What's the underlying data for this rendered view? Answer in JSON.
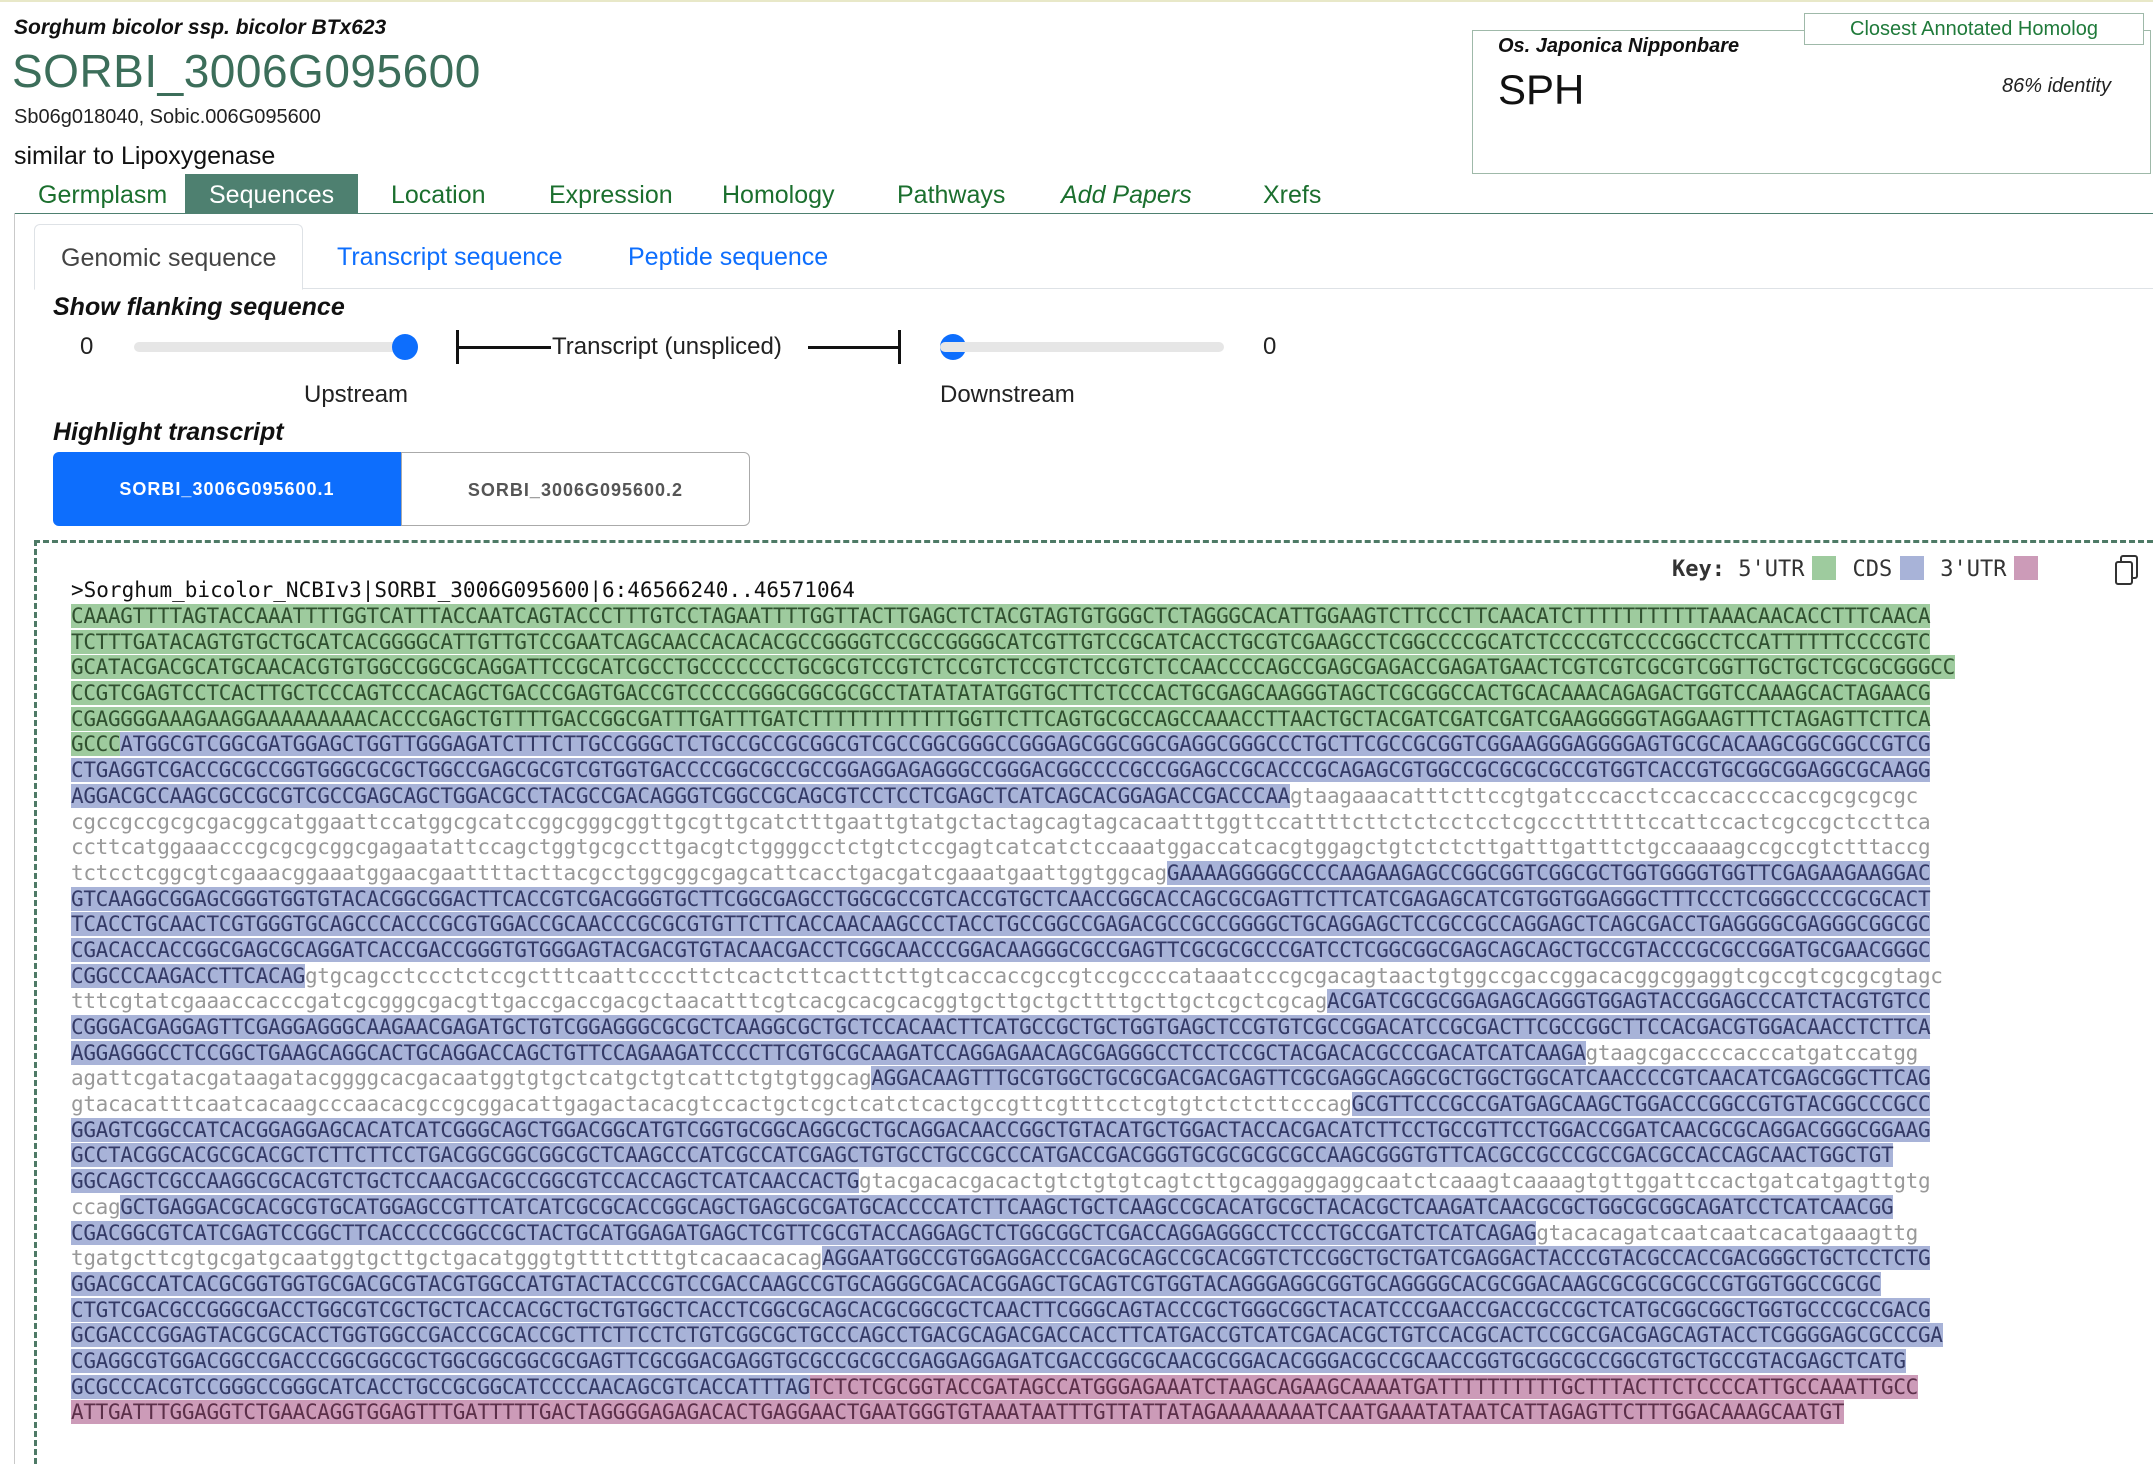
{
  "gene": {
    "species": "Sorghum bicolor ssp. bicolor BTx623",
    "id": "SORBI_3006G095600",
    "synonyms": "Sb06g018040, Sobic.006G095600",
    "description": "similar to Lipoxygenase"
  },
  "homolog": {
    "badge": "Closest Annotated Homolog",
    "species": "Os. Japonica Nipponbare",
    "name": "SPH",
    "identity": "86% identity"
  },
  "nav": {
    "tabs": [
      "Germplasm",
      "Sequences",
      "Location",
      "Expression",
      "Homology",
      "Pathways",
      "Add Papers",
      "Xrefs"
    ],
    "active": "Sequences"
  },
  "subtabs": {
    "items": [
      "Genomic sequence",
      "Transcript sequence",
      "Peptide sequence"
    ],
    "active": "Genomic sequence"
  },
  "flanking": {
    "title": "Show flanking sequence",
    "upstream_value": "0",
    "upstream_label": "Upstream",
    "downstream_value": "0",
    "downstream_label": "Downstream",
    "transcript_label": "Transcript (unspliced)"
  },
  "highlight": {
    "title": "Highlight transcript",
    "transcripts": [
      "SORBI_3006G095600.1",
      "SORBI_3006G095600.2"
    ],
    "active": "SORBI_3006G095600.1"
  },
  "key": {
    "label": "Key:",
    "utr5": "5'UTR",
    "cds": "CDS",
    "utr3": "3'UTR"
  },
  "colors": {
    "utr5": "#9ecb9e",
    "cds": "#a8b3d8",
    "utr3": "#cc9bb8",
    "intron_text": "#999999",
    "nav_active": "#4e8070",
    "link_green": "#1b6f2e",
    "link_blue": "#0d6efd"
  },
  "icons": {
    "copy": "copy-icon"
  },
  "sequence": {
    "header": ">Sorghum_bicolor_NCBIv3|SORBI_3006G095600|6:46566240..46571064",
    "lines": [
      [
        [
          "utr5",
          "CAAAGTTTTAGTACCAAATTTTGGTCATTTACCAATCAGTACCCTTTGTCCTAGAATTTTGGTTACTTGAGCTCTACGTAGTGTGGGCTCTAGGGCACATTGGAAGTCTTCCCTTCAACATCTTTTTTTTTTTAAACAACACCTTTCAACA"
        ]
      ],
      [
        [
          "utr5",
          "TCTTTGATACAGTGTGCTGCATCACGGGGCATTGTTGTCCGAATCAGCAACCACACACGCCGGGGTCCGCCGGGGCATCGTTGTCCGCATCACCTGCGTCGAAGCCTCGGCCCCGCATCTCCCCGTCCCCGGCCTCCATTTTTTCCCCGTC"
        ]
      ],
      [
        [
          "utr5",
          "GCATACGACGCATGCAACACGTGTGGCCGGCGCAGGATTCCGCATCGCCTGCCCCCCCTGCGCGTCCGTCTCCGTCTCCGTCTCCGTCTCCAACCCCAGCCGAGCGAGACCGAGATGAACTCGTCGTCGCGTCGGTTGCTGCTCGCGCGGGCC"
        ]
      ],
      [
        [
          "utr5",
          "CCGTCGAGTCCTCACTTGCTCCCAGTCCCACAGCTGACCCGAGTGACCGTCCCCCGGGCGGCGCGCCTATATATATGGTGCTTCTCCCACTGCGAGCAAGGGTAGCTCGCGGCCACTGCACAAACAGAGACTGGTCCAAAGCACTAGAACG"
        ]
      ],
      [
        [
          "utr5",
          "CGAGGGGAAAGAAGGAAAAAAAAACACCCGAGCTGTTTTGACCGGCGATTTGATTTGATCTTTTTTTTTTTTGGTTCTTCAGTGCGCCAGCCAAACCTTAACTGCTACGATCGATCGATCGAAGGGGGTAGGAAGTTTCTAGAGTTCTTCA"
        ]
      ],
      [
        [
          "utr5",
          "GCCC"
        ],
        [
          "cds",
          "ATGGCGTCGGCGATGGAGCTGGTTGGGAGATCTTTCTTGCCGGGCTCTGCCGCCGCGGCGTCGCCGGCGGGCCGGGAGCGGCGGCGAGGCGGGCCCTGCTTCGCCGCGGTCGGAAGGGAGGGGAGTGCGCACAAGCGGCGGCCGTCG"
        ]
      ],
      [
        [
          "cds",
          "CTGAGGTCGACCGCGCCGGTGGGCGCGCTGGCCGAGCGCGTCGTGGTGACCCCGGCGCCGCCGGAGGAGAGGGCCGGGACGGCCCCGCCGGAGCCGCACCCGCAGAGCGTGGCCGCGCGCGCCGTGGTCACCGTGCGGCGGAGGCGCAAGG"
        ]
      ],
      [
        [
          "cds",
          "AGGACGCCAAGCGCCGCGTCGCCGAGCAGCTGGACGCCTACGCCGACAGGGTCGGCCGCAGCGTCCTCCTCGAGCTCATCAGCACGGAGACCGACCCAA"
        ],
        [
          "intron",
          "gtaagaaacatttcttccgtgatcccacctccaccaccccaccgcgcgcgc"
        ]
      ],
      [
        [
          "intron",
          "cgccgccgcgcgacggcatggaattccatggcgcatccggcgggcggttgcgttgcatctttgaattgtatgctactagcagtagcacaatttggttccattttcttctctcctcctcgcccttttttccattccactcgccgctccttca"
        ]
      ],
      [
        [
          "intron",
          "ccttcatggaaacccgcgcgcggcgagaatattccagctggtgcgccttgacgtctggggcctctgtctccgagtcatcatctccaaatggaccatcacgtggagctgtctctcttgatttgatttctgccaaaagccgccgtctttaccg"
        ]
      ],
      [
        [
          "intron",
          "tctcctcggcgtcgaaacggaaatggaacgaattttacttacgcctggcggcgagcattcacctgacgatcgaaatgaattggtggcag"
        ],
        [
          "cds",
          "GAAAAGGGGGCCCCAAGAAGAGCCGGCGGTCGGCGCTGGTGGGGTGGTTCGAGAAGAAGGAC"
        ]
      ],
      [
        [
          "cds",
          "GTCAAGGCGGAGCGGGTGGTGTACACGGCGGACTTCACCGTCGACGGGTGCTTCGGCGAGCCTGGCGCCGTCACCGTGCTCAACCGGCACCAGCGCGAGTTCTTCATCGAGAGCATCGTGGTGGAGGGCTTTCCCTCGGGCCCCGCGCACT"
        ]
      ],
      [
        [
          "cds",
          "TCACCTGCAACTCGTGGGTGCAGCCCACCCGCGTGGACCGCAACCCGCGCGTGTTCTTCACCAACAAGCCCTACCTGCCGGCCGAGACGCCGCCGGGGCTGCAGGAGCTCCGCCGCCAGGAGCTCAGCGACCTGAGGGGCGAGGGCGGCGC"
        ]
      ],
      [
        [
          "cds",
          "CGACACCACCGGCGAGCGCAGGATCACCGACCGGGTGTGGGAGTACGACGTGTACAACGACCTCGGCAACCCGGACAAGGGCGCCGAGTTCGCGCGCCCGATCCTCGGCGGCGAGCAGCAGCTGCCGTACCCGCGCCGGATGCGAACGGGC"
        ]
      ],
      [
        [
          "cds",
          "CGGCCCAAGACCTTCACAG"
        ],
        [
          "intron",
          "gtgcagcctccctctccgctttcaattccccttctcactcttcacttcttgtcaccaccgccgtccgccccataaatcccgcgacagtaactgtggccgaccggacacggcggaggtcgccgtcgcgcgtagc"
        ]
      ],
      [
        [
          "intron",
          "tttcgtatcgaaaccacccgatcgcgggcgacgttgaccgaccgacgctaacatttcgtcacgcacgcacggtgcttgctgcttttgcttgctcgctcgcag"
        ],
        [
          "cds",
          "ACGATCGCGCGGAGAGCAGGGTGGAGTACCGGAGCCCATCTACGTGTCC"
        ]
      ],
      [
        [
          "cds",
          "CGGGACGAGGAGTTCGAGGAGGGCAAGAACGAGATGCTGTCGGAGGGCGCGCTCAAGGCGCTGCTCCACAACTTCATGCCGCTGCTGGTGAGCTCCGTGTCGCCGGACATCCGCGACTTCGCCGGCTTCCACGACGTGGACAACCTCTTCA"
        ]
      ],
      [
        [
          "cds",
          "AGGAGGGCCTCCGGCTGAAGCAGGCACTGCAGGACCAGCTGTTCCAGAAGATCCCCTTCGTGCGCAAGATCCAGGAGAACAGCGAGGGCCTCCTCCGCTACGACACGCCCGACATCATCAAGA"
        ],
        [
          "intron",
          "gtaagcgaccccacccatgatccatgg"
        ]
      ],
      [
        [
          "intron",
          "agattcgatacgataagatacggggcacgacaatggtgtgctcatgctgtcattctgtgtggcag"
        ],
        [
          "cds",
          "AGGACAAGTTTGCGTGGCTGCGCGACGACGAGTTCGCGAGGCAGGCGCTGGCTGGCATCAACCCCGTCAACATCGAGCGGCTTCAG"
        ]
      ],
      [
        [
          "intron",
          "gtacacatttcaatcacaagcccaacacgccgcggacattgagactacacgtccactgctcgctcatctcactgccgttcgtttcctcgtgtctctcttcccag"
        ],
        [
          "cds",
          "GCGTTCCCGCCGATGAGCAAGCTGGACCCGGCCGTGTACGGCCCGCC"
        ]
      ],
      [
        [
          "cds",
          "GGAGTCGGCCATCACGGAGGAGCACATCATCGGGCAGCTGGACGGCATGTCGGTGCGGCAGGCGCTGCAGGACAACCGGCTGTACATGCTGGACTACCACGACATCTTCCTGCCGTTCCTGGACCGGATCAACGCGCAGGACGGGCGGAAG"
        ]
      ],
      [
        [
          "cds",
          "GCCTACGGCACGCGCACGCTCTTCTTCCTGACGGCGGCGGCGCTCAAGCCCATCGCCATCGAGCTGTGCCTGCCGCCCATGACCGACGGGTGCGCGCGCGCCAAGCGGGTGTTCACGCCGCCCGCCGACGCCACCAGCAACTGGCTGT"
        ]
      ],
      [
        [
          "cds",
          "GGCAGCTCGCCAAGGCGCACGTCTGCTCCAACGACGCCGGCGTCCACCAGCTCATCAACCACTG"
        ],
        [
          "intron",
          "gtacgacacgacactgtctgtgtcagtcttgcaggaggaggcaatctcaaagtcaaaagtgttggattccactgatcatgagttgtg"
        ]
      ],
      [
        [
          "intron",
          "ccag"
        ],
        [
          "cds",
          "GCTGAGGACGCACGCGTGCATGGAGCCGTTCATCATCGCGCACCGGCAGCTGAGCGCGATGCACCCCATCTTCAAGCTGCTCAAGCCGCACATGCGCTACACGCTCAAGATCAACGCGCTGGCGCGGCAGATCCTCATCAACGG"
        ]
      ],
      [
        [
          "cds",
          "CGACGGCGTCATCGAGTCCGGCTTCACCCCCGGCCGCTACTGCATGGAGATGAGCTCGTTCGCGTACCAGGAGCTCTGGCGGCTCGACCAGGAGGGCCTCCCTGCCGATCTCATCAGAG"
        ],
        [
          "intron",
          "gtacacagatcaatcaatcacatgaaagttg"
        ]
      ],
      [
        [
          "intron",
          "tgatgcttcgtgcgatgcaatggtgcttgctgacatgggtgttttctttgtcacaacacag"
        ],
        [
          "cds",
          "AGGAATGGCCGTGGAGGACCCGACGCAGCCGCACGGTCTCCGGCTGCTGATCGAGGACTACCCGTACGCCACCGACGGGCTGCTCCTCTG"
        ]
      ],
      [
        [
          "cds",
          "GGACGCCATCACGCGGTGGTGCGACGCGTACGTGGCCATGTACTACCCGTCCGACCAAGCCGTGCAGGGCGACACGGAGCTGCAGTCGTGGTACAGGGAGGCGGTGCAGGGGCACGCGGACAAGCGCGCGCGCCGTGGTGGCCGCGC"
        ]
      ],
      [
        [
          "cds",
          "CTGTCGACGCCGGGCGACCTGGCGTCGCTGCTCACCACGCTGCTGTGGCTCACCTCGGCGCAGCACGCGGCGCTCAACTTCGGGCAGTACCCGCTGGGCGGCTACATCCCGAACCGACCGCCGCTCATGCGGCGGCTGGTGCCCGCCGACG"
        ]
      ],
      [
        [
          "cds",
          "GCGACCCGGAGTACGCGCACCTGGTGGCCGACCCGCACCGCTTCTTCCTCTGTCGGCGCTGCCCAGCCTGACGCAGACGACCACCTTCATGACCGTCATCGACACGCTGTCCACGCACTCCGCCGACGAGCAGTACCTCGGGGAGCGCCCGA"
        ]
      ],
      [
        [
          "cds",
          "CGAGGCGTGGACGGCCGACCCGGCGGCGCTGGCGGCGGCGCGAGTTCGCGGACGAGGTGCGCCGCGCCGAGGAGGAGATCGACCGGCGCAACGCGGACACGGGACGCCGCAACCGGTGCGGCGCCGGCGTGCTGCCGTACGAGCTCATG"
        ]
      ],
      [
        [
          "cds",
          "GCGCCCACGTCCGGGCCGGGCATCACCTGCCGCGGCATCCCCAACAGCGTCACCATTTAG"
        ],
        [
          "utr3",
          "TCTCTCGCGGTACCGATAGCCATGGGAGAAATCTAAGCAGAAGCAAAATGATTTTTTTTTTGCTTTACTTCTCCCCATTGCCAAATTGCC"
        ]
      ],
      [
        [
          "utr3",
          "ATTGATTTGGAGGTCTGAACAGGTGGAGTTTGATTTTTGACTAGGGGAGAGACACTGAGGAACTGAATGGGTGTAAATAATTTGTTATTATAGAAAAAAAATCAATGAAATATAATCATTAGAGTTCTTTGGACAAAGCAATGT"
        ]
      ]
    ]
  }
}
